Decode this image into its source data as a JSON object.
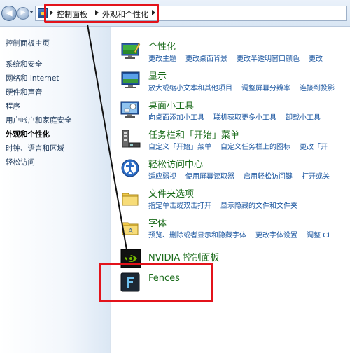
{
  "breadcrumb": {
    "items": [
      "控制面板",
      "外观和个性化"
    ]
  },
  "sidebar": {
    "items": [
      {
        "label": "控制面板主页",
        "active": false
      },
      {
        "label": "系统和安全",
        "active": false
      },
      {
        "label": "网络和 Internet",
        "active": false
      },
      {
        "label": "硬件和声音",
        "active": false
      },
      {
        "label": "程序",
        "active": false
      },
      {
        "label": "用户帐户和家庭安全",
        "active": false
      },
      {
        "label": "外观和个性化",
        "active": true
      },
      {
        "label": "时钟、语言和区域",
        "active": false
      },
      {
        "label": "轻松访问",
        "active": false
      }
    ]
  },
  "categories": [
    {
      "title": "个性化",
      "icon": "personalization-icon",
      "links": [
        "更改主题",
        "更改桌面背景",
        "更改半透明窗口颜色",
        "更改"
      ]
    },
    {
      "title": "显示",
      "icon": "display-icon",
      "links": [
        "放大或缩小文本和其他项目",
        "调整屏幕分辨率",
        "连接到投影"
      ]
    },
    {
      "title": "桌面小工具",
      "icon": "gadgets-icon",
      "links": [
        "向桌面添加小工具",
        "联机获取更多小工具",
        "卸载小工具"
      ]
    },
    {
      "title": "任务栏和「开始」菜单",
      "icon": "taskbar-icon",
      "links": [
        "自定义「开始」菜单",
        "自定义任务栏上的图标",
        "更改「开"
      ]
    },
    {
      "title": "轻松访问中心",
      "icon": "ease-of-access-icon",
      "links": [
        "适应弱视",
        "使用屏幕读取器",
        "启用轻松访问键",
        "打开或关"
      ]
    },
    {
      "title": "文件夹选项",
      "icon": "folder-options-icon",
      "links": [
        "指定单击或双击打开",
        "显示隐藏的文件和文件夹"
      ]
    },
    {
      "title": "字体",
      "icon": "fonts-icon",
      "links": [
        "预览、删除或者显示和隐藏字体",
        "更改字体设置",
        "调整 Cl"
      ]
    },
    {
      "title": "NVIDIA 控制面板",
      "icon": "nvidia-icon",
      "links": []
    },
    {
      "title": "Fences",
      "icon": "fences-icon",
      "links": []
    }
  ]
}
